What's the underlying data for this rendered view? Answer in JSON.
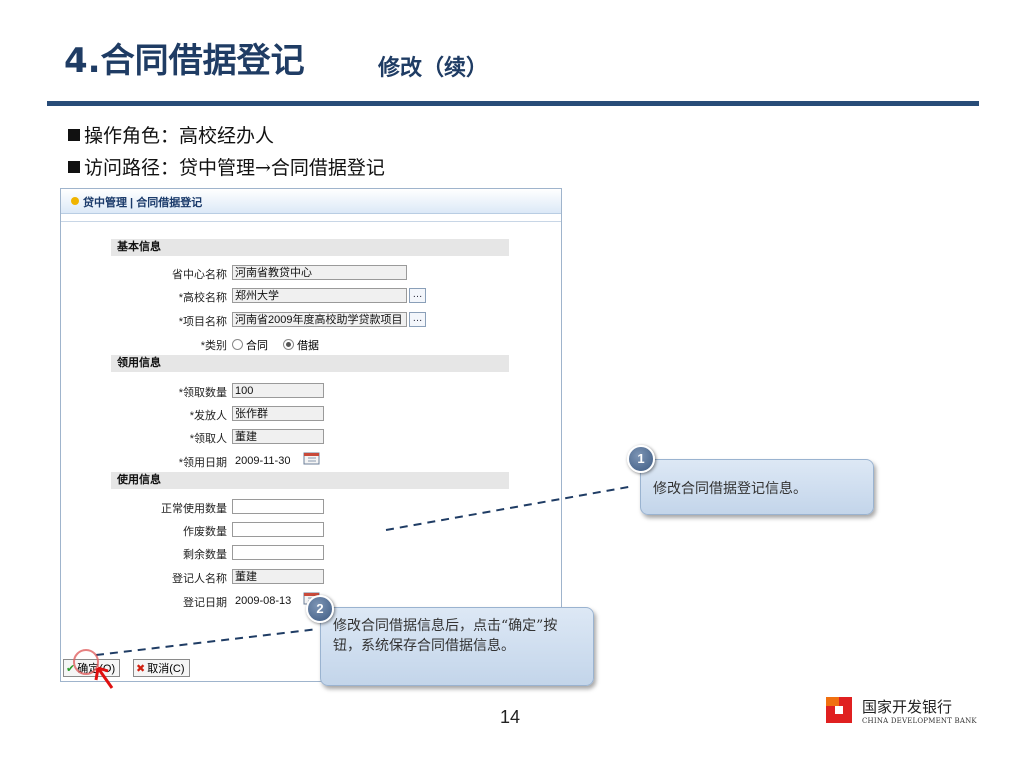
{
  "slide": {
    "title": "4.合同借据登记",
    "subtitle": "修改（续）",
    "bullets": [
      "操作角色：高校经办人",
      "访问路径：贷中管理→合同借据登记"
    ],
    "page_number": "14",
    "bank_name": "国家开发银行",
    "bank_name_en": "CHINA DEVELOPMENT BANK"
  },
  "app": {
    "breadcrumb": "贷中管理 | 合同借据登记",
    "sections": {
      "basic": "基本信息",
      "receive": "领用信息",
      "use": "使用信息"
    },
    "fields": {
      "center_label": "省中心名称",
      "center_value": "河南省教贷中心",
      "school_label": "*高校名称",
      "school_value": "郑州大学",
      "project_label": "*项目名称",
      "project_value": "河南省2009年度高校助学贷款项目",
      "type_label": "*类别",
      "type_opt1": "合同",
      "type_opt2": "借据",
      "qty_label": "*领取数量",
      "qty_value": "100",
      "issuer_label": "*发放人",
      "issuer_value": "张作群",
      "receiver_label": "*领取人",
      "receiver_value": "董建",
      "recv_date_label": "*领用日期",
      "recv_date_value": "2009-11-30",
      "normal_label": "正常使用数量",
      "normal_value": "",
      "void_label": "作废数量",
      "void_value": "",
      "remain_label": "剩余数量",
      "remain_value": "",
      "reg_person_label": "登记人名称",
      "reg_person_value": "董建",
      "reg_date_label": "登记日期",
      "reg_date_value": "2009-08-13"
    },
    "buttons": {
      "ok": "确定(O)",
      "cancel": "取消(C)"
    }
  },
  "callouts": [
    {
      "number": "1",
      "text": "修改合同借据登记信息。"
    },
    {
      "number": "2",
      "text": "修改合同借据信息后，点击“确定”按钮，系统保存合同借据信息。"
    }
  ],
  "colors": {
    "title": "#1f3c64",
    "rule": "#284c78",
    "callout_bg": "#c3d5ea",
    "badge": "#3d5a82"
  }
}
